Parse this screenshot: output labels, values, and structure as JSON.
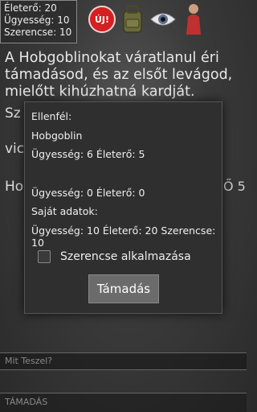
{
  "stats": {
    "eletero": "Életerő: 20",
    "ugyesseg": "Ügyesség: 10",
    "szerencse": "Szerencse: 10"
  },
  "icons": {
    "new_label": "ÚJ!",
    "items": [
      "new-badge-icon",
      "backpack-icon",
      "eye-icon",
      "character-icon"
    ]
  },
  "story": {
    "line1": "A Hobgoblinokat váratlanul éri",
    "line2": "támadásod, és az elsőt levágod,",
    "line3": "mielőtt kihúzhatná kardját.",
    "partial1": "Sz",
    "partial2": "vic",
    "partial3": "Ho",
    "partial_right": "Ő 5"
  },
  "dialog": {
    "enemy_header": "Ellenfél:",
    "enemy_name": "Hobgoblin",
    "enemy_stats": "Ügyesség: 6 Életerő: 5",
    "enemy2_stats": "Ügyesség: 0 Életerő: 0",
    "own_header": "Saját adatok:",
    "own_stats": "Ügyesség: 10 Életerő: 20 Szerencse: 10",
    "luck_label": "Szerencse alkalmazása",
    "luck_checked": false,
    "attack_label": "Támadás"
  },
  "input": {
    "placeholder": "Mit Teszel?"
  },
  "action": {
    "label": "TÁMADÁS"
  }
}
